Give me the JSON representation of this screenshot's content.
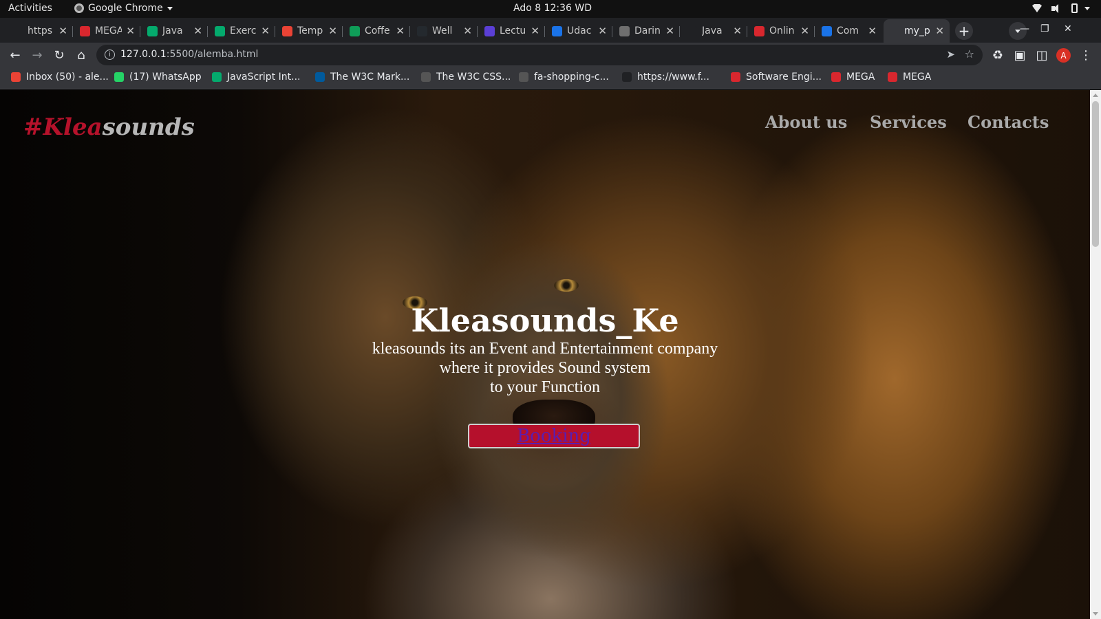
{
  "system_bar": {
    "activities": "Activities",
    "app_name": "Google Chrome",
    "clock": "Ado 8  12:36 WD"
  },
  "tabs": [
    {
      "title": "https",
      "icon": "a-letter-icon",
      "color": "#202124"
    },
    {
      "title": "MEGA",
      "icon": "mega-icon",
      "color": "#d9272e"
    },
    {
      "title": "Java",
      "icon": "w-icon",
      "color": "#04aa6d"
    },
    {
      "title": "Exerc",
      "icon": "w-icon",
      "color": "#04aa6d"
    },
    {
      "title": "Temp",
      "icon": "gmail-icon",
      "color": "#ea4335"
    },
    {
      "title": "Coffe",
      "icon": "sheets-plus-icon",
      "color": "#0f9d58"
    },
    {
      "title": "Well",
      "icon": "github-icon",
      "color": "#24292e"
    },
    {
      "title": "Lectu",
      "icon": "c-letter-icon",
      "color": "#5b3fd6"
    },
    {
      "title": "Udac",
      "icon": "udacity-icon",
      "color": "#1a73e8"
    },
    {
      "title": "Darin",
      "icon": "star-icon",
      "color": "#6f6f6f"
    },
    {
      "title": "Java",
      "icon": "m-letter-icon",
      "color": "#202124"
    },
    {
      "title": "Onlin",
      "icon": "ring-icon",
      "color": "#d9272e"
    },
    {
      "title": "Com",
      "icon": "play-icon",
      "color": "#1a73e8"
    },
    {
      "title": "my_p",
      "icon": "globe-icon",
      "color": "#35363a"
    }
  ],
  "address_bar": {
    "host": "127.0.0.1",
    "path": ":5500/alemba.html"
  },
  "profile_initial": "A",
  "bookmarks": [
    {
      "label": "Inbox (50) - ale...",
      "icon": "gmail-icon",
      "color": "#ea4335"
    },
    {
      "label": "(17) WhatsApp",
      "icon": "whatsapp-icon",
      "color": "#25d366"
    },
    {
      "label": "JavaScript Int...",
      "icon": "w-icon",
      "color": "#04aa6d"
    },
    {
      "label": "The W3C Mark...",
      "icon": "w3c-icon",
      "color": "#005a9c"
    },
    {
      "label": "The W3C CSS...",
      "icon": "css-icon",
      "color": "#555555"
    },
    {
      "label": "fa-shopping-c...",
      "icon": "flag-icon",
      "color": "#555555"
    },
    {
      "label": "https://www.f...",
      "icon": "a-letter-icon",
      "color": "#202124"
    },
    {
      "label": "Software Engi...",
      "icon": "ring-icon",
      "color": "#d9272e"
    },
    {
      "label": "MEGA",
      "icon": "mega-icon",
      "color": "#d9272e"
    },
    {
      "label": "MEGA",
      "icon": "mega-icon",
      "color": "#d9272e"
    }
  ],
  "page": {
    "brand_hash": "#Klea",
    "brand_rest": "sounds",
    "nav": [
      "About us",
      "Services",
      "Contacts"
    ],
    "hero_title": "Kleasounds_Ke",
    "hero_lines": [
      "kleasounds its an Event and Entertainment company",
      "where it provides Sound system",
      "to your Function"
    ],
    "booking_label": "Booking",
    "colors": {
      "accent": "#b5122b",
      "link": "#5a1db0"
    }
  }
}
